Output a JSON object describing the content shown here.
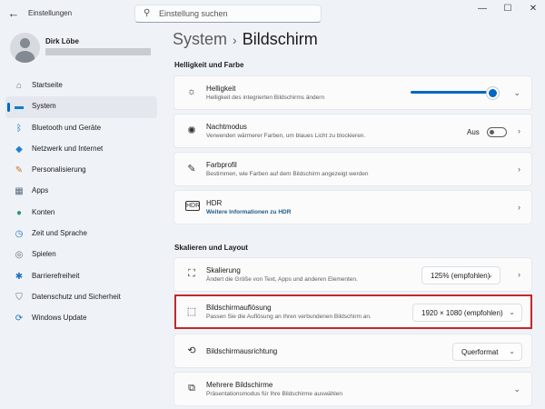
{
  "window": {
    "app_title": "Einstellungen",
    "back_icon": "back-arrow-icon",
    "controls": [
      "—",
      "☐",
      "✕"
    ]
  },
  "search": {
    "placeholder": "Einstellung suchen",
    "icon": "search-icon"
  },
  "user": {
    "name": "Dirk Löbe"
  },
  "sidebar": {
    "items": [
      {
        "label": "Startseite",
        "icon": "home-icon",
        "glyph": "⌂",
        "color": "#6b6b6b",
        "active": false
      },
      {
        "label": "System",
        "icon": "display-icon",
        "glyph": "▬",
        "color": "#0a7dd6",
        "active": true
      },
      {
        "label": "Bluetooth und Geräte",
        "icon": "bluetooth-icon",
        "glyph": "ᛒ",
        "color": "#0f6cbd",
        "active": false
      },
      {
        "label": "Netzwerk und Internet",
        "icon": "wifi-icon",
        "glyph": "◆",
        "color": "#1e7fd6",
        "active": false
      },
      {
        "label": "Personalisierung",
        "icon": "brush-icon",
        "glyph": "✎",
        "color": "#c9752b",
        "active": false
      },
      {
        "label": "Apps",
        "icon": "apps-icon",
        "glyph": "▦",
        "color": "#5d6b7a",
        "active": false
      },
      {
        "label": "Konten",
        "icon": "account-icon",
        "glyph": "●",
        "color": "#2a9d6a",
        "active": false
      },
      {
        "label": "Zeit und Sprache",
        "icon": "globe-clock-icon",
        "glyph": "◷",
        "color": "#1f6fbf",
        "active": false
      },
      {
        "label": "Spielen",
        "icon": "gamepad-icon",
        "glyph": "◎",
        "color": "#6b6b6b",
        "active": false
      },
      {
        "label": "Barrierefreiheit",
        "icon": "accessibility-icon",
        "glyph": "✱",
        "color": "#1f6fbf",
        "active": false
      },
      {
        "label": "Datenschutz und Sicherheit",
        "icon": "shield-icon",
        "glyph": "⛉",
        "color": "#6b6b6b",
        "active": false
      },
      {
        "label": "Windows Update",
        "icon": "update-icon",
        "glyph": "⟳",
        "color": "#1f6fbf",
        "active": false
      }
    ]
  },
  "breadcrumb": {
    "root": "System",
    "separator": "›",
    "current": "Bildschirm"
  },
  "sections": {
    "brightness_color": "Helligkeit und Farbe",
    "scale_layout": "Skalieren und Layout"
  },
  "cards": {
    "brightness": {
      "title": "Helligkeit",
      "sub": "Helligkeit des integrierten Bildschirms ändern",
      "value_fraction": 0.92
    },
    "night": {
      "title": "Nachtmodus",
      "sub": "Verwenden wärmerer Farben, um blaues Licht zu blockieren.",
      "toggle_label": "Aus"
    },
    "profile": {
      "title": "Farbprofil",
      "sub": "Bestimmen, wie Farben auf dem Bildschirm angezeigt werden"
    },
    "hdr": {
      "title": "HDR",
      "link": "Weitere Informationen zu HDR"
    },
    "scale": {
      "title": "Skalierung",
      "sub": "Ändert die Größe von Text, Apps und anderen Elementen.",
      "value": "125% (empfohlen)"
    },
    "resolution": {
      "title": "Bildschirmauflösung",
      "sub": "Passen Sie die Auflösung an Ihren verbundenen Bildschirm an.",
      "value": "1920 × 1080 (empfohlen)"
    },
    "orientation": {
      "title": "Bildschirmausrichtung",
      "value": "Querformat"
    },
    "multi": {
      "title": "Mehrere Bildschirme",
      "sub": "Präsentationsmodus für Ihre Bildschirme auswählen"
    }
  },
  "colors": {
    "accent": "#0067c0",
    "highlight_border": "#c4282d"
  }
}
